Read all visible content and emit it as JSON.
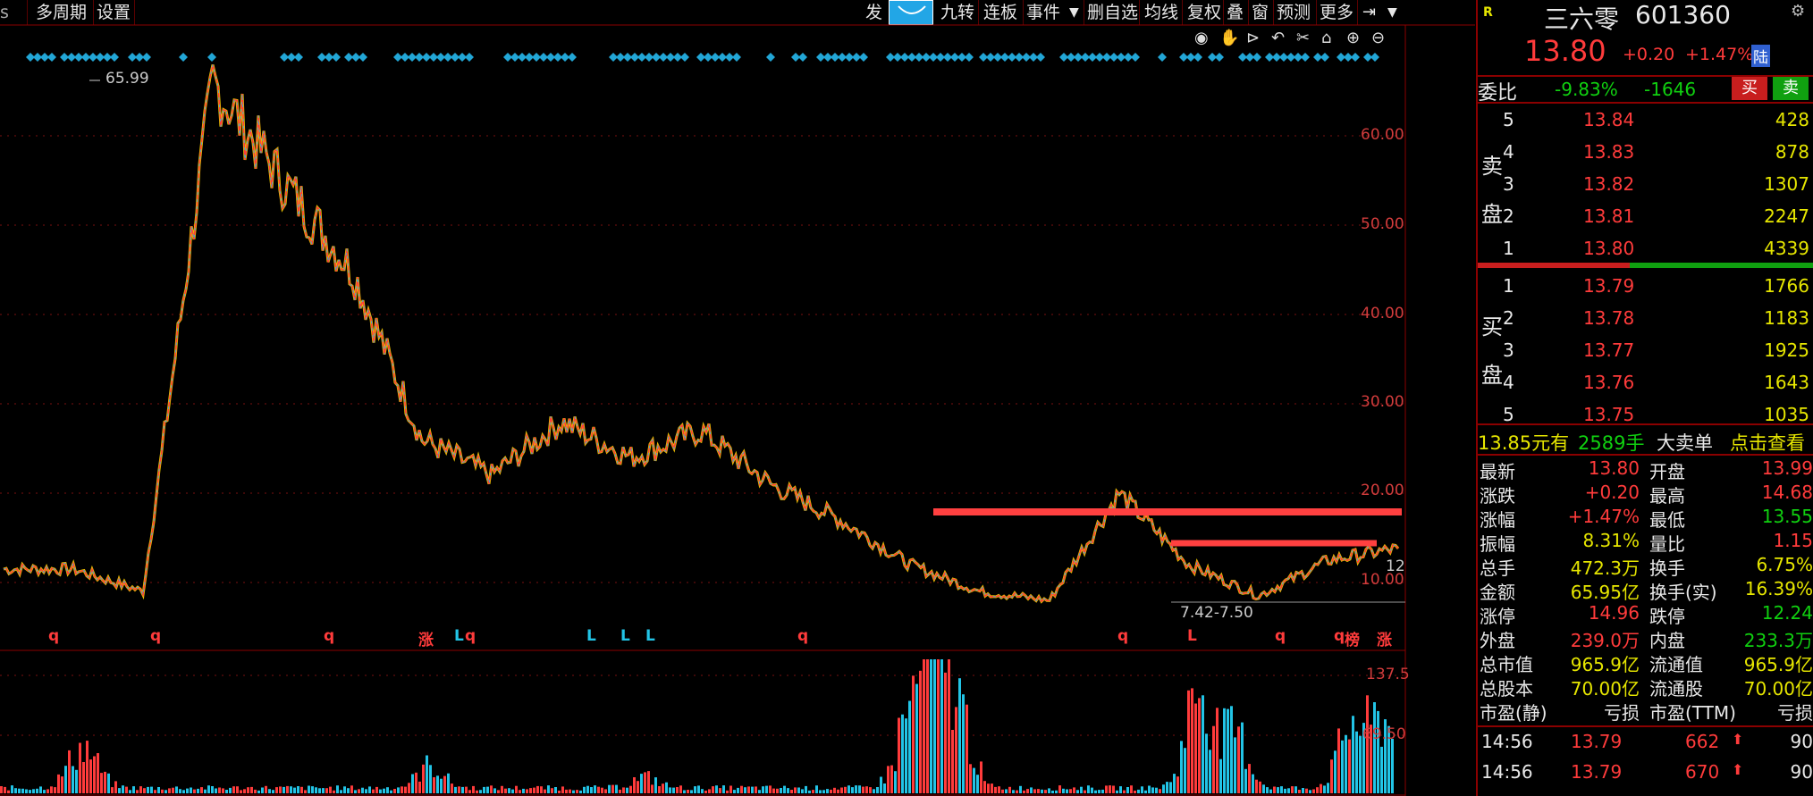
{
  "toolbar": {
    "left_items": [
      "多周期",
      "设置"
    ],
    "right_items": [
      "发",
      "九转",
      "连板",
      "事件",
      "删自选",
      "均线",
      "复权",
      "叠",
      "窗",
      "预测",
      "更多"
    ]
  },
  "chart": {
    "peak_label": "65.99",
    "range_label": "7.42-7.50",
    "last_label": "12",
    "y_ticks": [
      "60.00",
      "50.00",
      "40.00",
      "30.00",
      "20.00",
      "10.00"
    ],
    "vol_ticks": [
      "137.5",
      "69.50"
    ],
    "markers": [
      "q",
      "q",
      "q",
      "涨",
      "L",
      "q",
      "L",
      "L",
      "L",
      "q",
      "q",
      "L",
      "q",
      "q",
      "榜",
      "涨"
    ]
  },
  "chart_data": {
    "type": "line",
    "title": "",
    "ylabel": "",
    "ylim": [
      0,
      70
    ],
    "x": [
      0,
      5,
      10,
      15,
      20,
      25,
      30,
      35,
      40,
      45,
      50,
      55,
      60,
      65,
      70,
      75,
      80,
      85,
      90,
      95,
      100
    ],
    "series": [
      {
        "values": [
          11.5,
          11.5,
          9.0,
          65.99,
          55.0,
          45.0,
          26.0,
          22.0,
          28.0,
          24.0,
          27.0,
          21.0,
          17.0,
          12.0,
          9.0,
          8.0,
          20.0,
          12.0,
          8.5,
          12.5,
          13.8
        ]
      }
    ],
    "volume_ticks": [
      137.5,
      69.5
    ]
  },
  "quote": {
    "flag": "R",
    "name": "三六零",
    "code": "601360",
    "price": "13.80",
    "change": "+0.20",
    "change_pct": "+1.47%",
    "lu_badge": "陆",
    "weibi_label": "委比",
    "weibi_pct": "-9.83%",
    "weibi_diff": "-1646",
    "buy_btn": "买",
    "sell_btn": "卖",
    "sell_label": [
      "卖",
      "盘"
    ],
    "buy_label": [
      "买",
      "盘"
    ],
    "asks": [
      {
        "lvl": "5",
        "price": "13.84",
        "vol": "428"
      },
      {
        "lvl": "4",
        "price": "13.83",
        "vol": "878"
      },
      {
        "lvl": "3",
        "price": "13.82",
        "vol": "1307"
      },
      {
        "lvl": "2",
        "price": "13.81",
        "vol": "2247"
      },
      {
        "lvl": "1",
        "price": "13.80",
        "vol": "4339"
      }
    ],
    "bids": [
      {
        "lvl": "1",
        "price": "13.79",
        "vol": "1766"
      },
      {
        "lvl": "2",
        "price": "13.78",
        "vol": "1183"
      },
      {
        "lvl": "3",
        "price": "13.77",
        "vol": "1925"
      },
      {
        "lvl": "4",
        "price": "13.76",
        "vol": "1643"
      },
      {
        "lvl": "5",
        "price": "13.75",
        "vol": "1035"
      }
    ],
    "bigorder": {
      "price": "13.85元有",
      "qty": "2589手",
      "label": "大卖单",
      "link": "点击查看"
    },
    "stats": [
      {
        "k1": "最新",
        "v1": "13.80",
        "c1": "red",
        "k2": "开盘",
        "v2": "13.99",
        "c2": "red"
      },
      {
        "k1": "涨跌",
        "v1": "+0.20",
        "c1": "red",
        "k2": "最高",
        "v2": "14.68",
        "c2": "red"
      },
      {
        "k1": "涨幅",
        "v1": "+1.47%",
        "c1": "red",
        "k2": "最低",
        "v2": "13.55",
        "c2": "green"
      },
      {
        "k1": "振幅",
        "v1": "8.31%",
        "c1": "yellow",
        "k2": "量比",
        "v2": "1.15",
        "c2": "red"
      },
      {
        "k1": "总手",
        "v1": "472.3万",
        "c1": "yellow",
        "k2": "换手",
        "v2": "6.75%",
        "c2": "yellow"
      },
      {
        "k1": "金额",
        "v1": "65.95亿",
        "c1": "yellow",
        "k2": "换手(实)",
        "v2": "16.39%",
        "c2": "yellow"
      },
      {
        "k1": "涨停",
        "v1": "14.96",
        "c1": "red",
        "k2": "跌停",
        "v2": "12.24",
        "c2": "green"
      },
      {
        "k1": "外盘",
        "v1": "239.0万",
        "c1": "red",
        "k2": "内盘",
        "v2": "233.3万",
        "c2": "green"
      },
      {
        "k1": "总市值",
        "v1": "965.9亿",
        "c1": "yellow",
        "k2": "流通值",
        "v2": "965.9亿",
        "c2": "yellow"
      },
      {
        "k1": "总股本",
        "v1": "70.00亿",
        "c1": "yellow",
        "k2": "流通股",
        "v2": "70.00亿",
        "c2": "yellow"
      },
      {
        "k1": "市盈(静)",
        "v1": "亏损",
        "c1": "white",
        "k2": "市盈(TTM)",
        "v2": "亏损",
        "c2": "white"
      }
    ],
    "ticks": [
      {
        "time": "14:56",
        "price": "13.79",
        "vol": "662",
        "num": "90"
      },
      {
        "time": "14:56",
        "price": "13.79",
        "vol": "670",
        "num": "90"
      }
    ],
    "colors": {
      "up": "#ff3b3b",
      "down": "#10d010",
      "accent": "#22c4e6",
      "yellow": "#e6e600"
    }
  }
}
